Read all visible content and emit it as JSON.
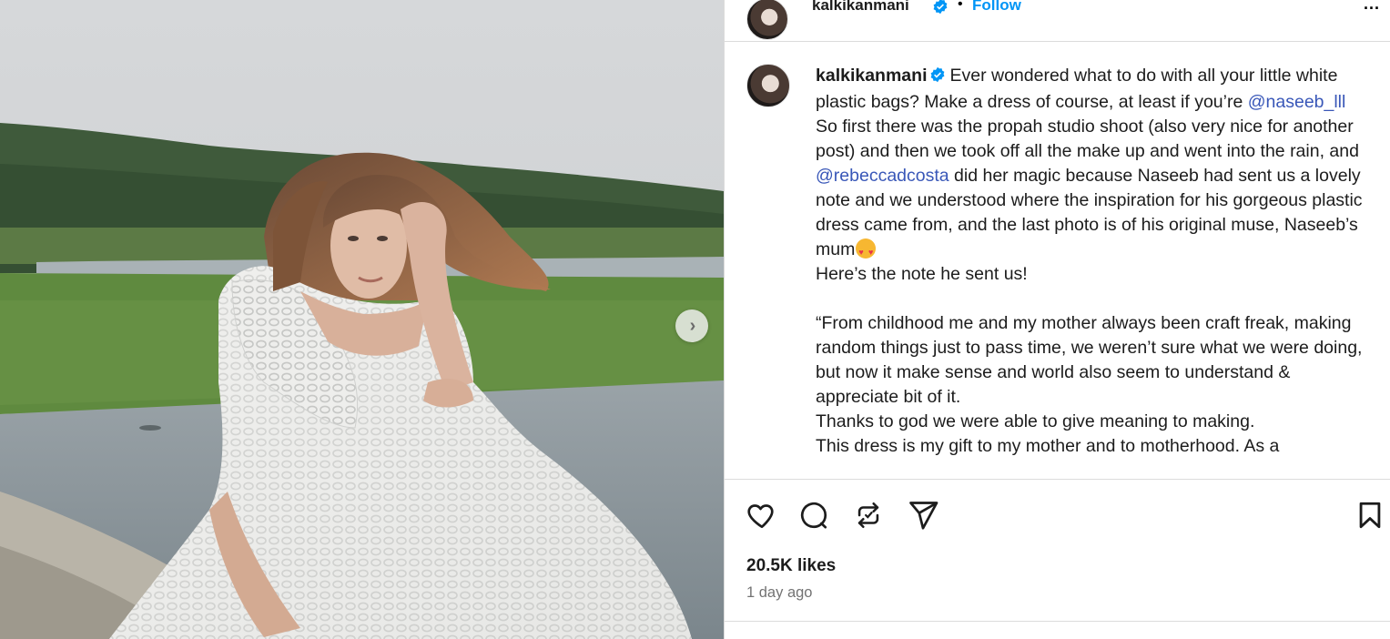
{
  "post": {
    "username": "kalkikanmani",
    "follow_label": "Follow",
    "more_label": "...",
    "separator": "•"
  },
  "caption": {
    "username": "kalkikanmani",
    "line1_a": "Ever wondered what to do with all your little white plastic bags? Make a dress of course, at least if you’re ",
    "mention1": "@naseeb_lll",
    "line2_a": "So first there was the propah studio shoot (also very nice for another post) and then we took off all the make up and went into the rain, and ",
    "mention2": "@rebeccadcosta",
    "line2_b": " did her magic because Naseeb had sent us a lovely note and we understood where the inspiration for his gorgeous plastic dress came from, and the last photo is of his original muse, Naseeb’s mum",
    "line3": "Here’s the note he sent us!",
    "line4": "“From childhood me and my mother always been craft freak, making random things just to pass time, we weren’t sure what we were doing, but now it make sense and world also seem to understand & appreciate bit of it.",
    "line5": "Thanks to god we were able to give meaning to making.",
    "line6": "This dress is my gift to my mother and to motherhood. As a"
  },
  "actions": {
    "like_icon": "heart-icon",
    "comment_icon": "comment-icon",
    "repost_icon": "repost-icon",
    "share_icon": "send-icon",
    "save_icon": "bookmark-icon"
  },
  "stats": {
    "likes": "20.5K likes",
    "time": "1 day ago"
  },
  "media": {
    "next_label": "›"
  },
  "colors": {
    "mention": "#3957b8",
    "follow": "#0095f6",
    "verified": "#0095f6",
    "muted": "#737373",
    "border": "#dbdbdb"
  }
}
